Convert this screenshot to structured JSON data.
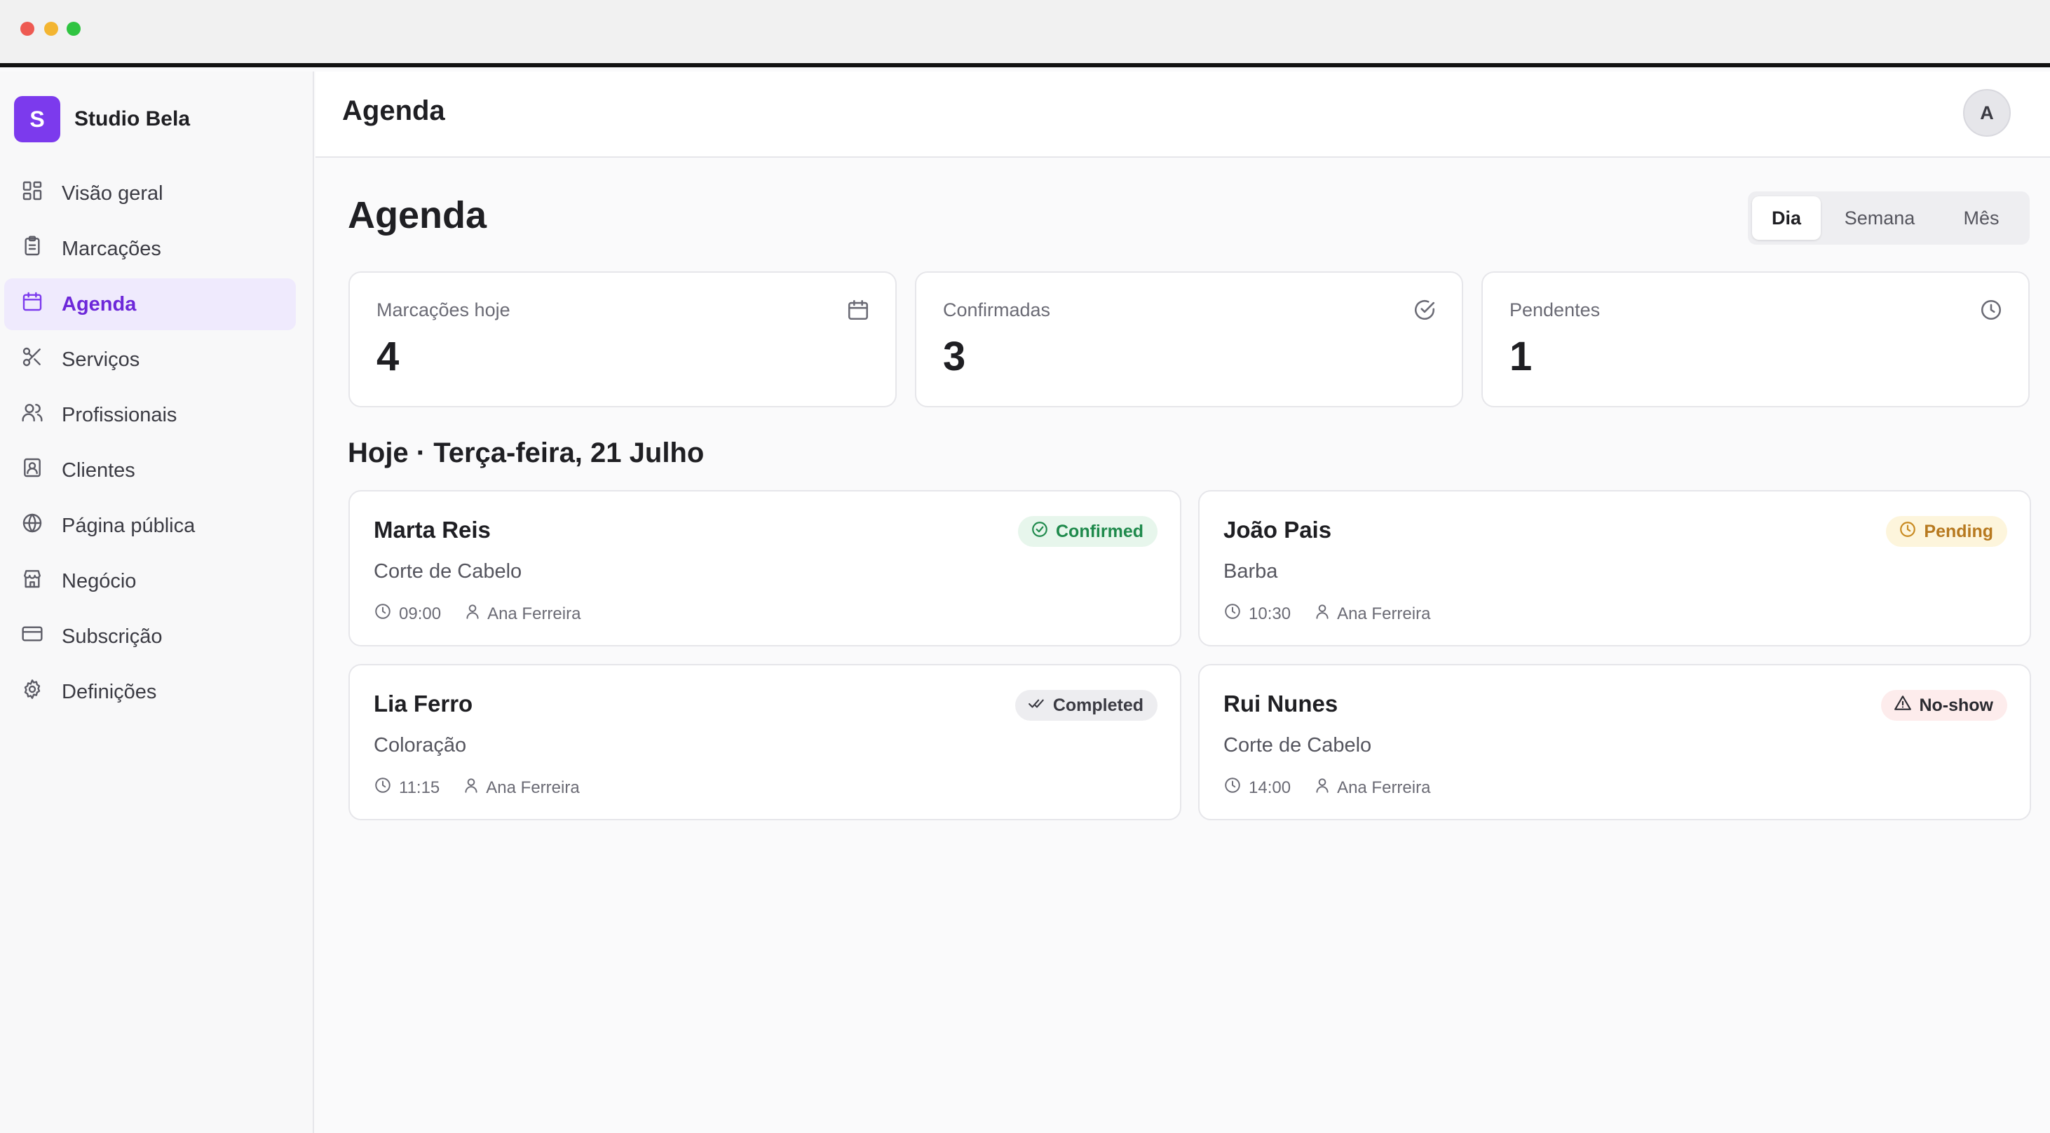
{
  "brand": {
    "logo_letter": "S",
    "name": "Studio Bela"
  },
  "sidebar": {
    "items": [
      {
        "label": "Visão geral",
        "icon": "grid-icon",
        "active": false
      },
      {
        "label": "Marcações",
        "icon": "clipboard-icon",
        "active": false
      },
      {
        "label": "Agenda",
        "icon": "calendar-icon",
        "active": true
      },
      {
        "label": "Serviços",
        "icon": "scissors-icon",
        "active": false
      },
      {
        "label": "Profissionais",
        "icon": "users-icon",
        "active": false
      },
      {
        "label": "Clientes",
        "icon": "contact-icon",
        "active": false
      },
      {
        "label": "Página pública",
        "icon": "globe-icon",
        "active": false
      },
      {
        "label": "Negócio",
        "icon": "store-icon",
        "active": false
      },
      {
        "label": "Subscrição",
        "icon": "credit-card-icon",
        "active": false
      },
      {
        "label": "Definições",
        "icon": "gear-icon",
        "active": false
      }
    ]
  },
  "header": {
    "title": "Agenda",
    "avatar_letter": "A"
  },
  "main": {
    "title": "Agenda",
    "view_toggle": {
      "options": [
        "Dia",
        "Semana",
        "Mês"
      ],
      "selected": "Dia"
    },
    "stats": [
      {
        "label": "Marcações hoje",
        "value": "4",
        "icon": "calendar-icon"
      },
      {
        "label": "Confirmadas",
        "value": "3",
        "icon": "check-circle-icon"
      },
      {
        "label": "Pendentes",
        "value": "1",
        "icon": "clock-icon"
      }
    ],
    "section_title": "Hoje · Terça-feira, 21 Julho",
    "appointments": [
      {
        "client": "Marta Reis",
        "service": "Corte de Cabelo",
        "time": "09:00",
        "staff": "Ana Ferreira",
        "status": "Confirmed",
        "status_icon": "check-circle-icon"
      },
      {
        "client": "João Pais",
        "service": "Barba",
        "time": "10:30",
        "staff": "Ana Ferreira",
        "status": "Pending",
        "status_icon": "clock-icon"
      },
      {
        "client": "Lia Ferro",
        "service": "Coloração",
        "time": "11:15",
        "staff": "Ana Ferreira",
        "status": "Completed",
        "status_icon": "double-check-icon"
      },
      {
        "client": "Rui Nunes",
        "service": "Corte de Cabelo",
        "time": "14:00",
        "staff": "Ana Ferreira",
        "status": "No-show",
        "status_icon": "warning-icon"
      }
    ]
  },
  "colors": {
    "accent": "#7c3aed",
    "active_nav_bg": "#efeafd",
    "confirmed": "#1f8a4c",
    "pending": "#b7791f",
    "completed_bg": "#ededf0",
    "noshow_bg": "#fdecec"
  }
}
